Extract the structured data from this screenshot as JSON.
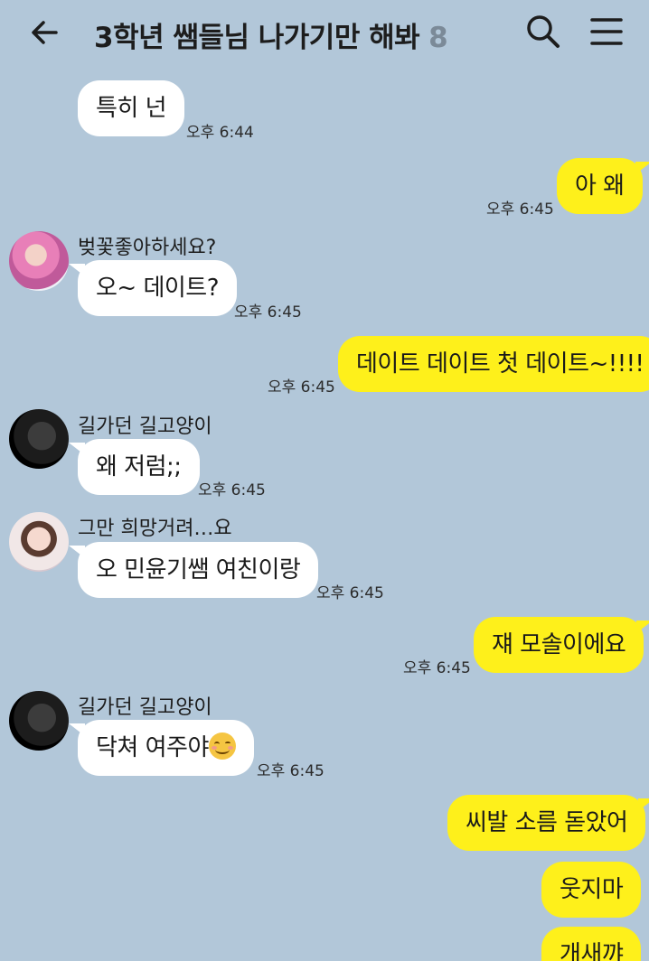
{
  "header": {
    "title": "3학년 쌤들님 나가기만 해봐",
    "member_count": "8",
    "back_icon": "arrow-left-icon",
    "search_icon": "search-icon",
    "menu_icon": "hamburger-menu-icon"
  },
  "colors": {
    "background": "#b2c7d9",
    "incoming_bubble": "#ffffff",
    "outgoing_bubble": "#fef01b"
  },
  "messages": [
    {
      "direction": "in",
      "sender": "",
      "text": "특히 넌",
      "time": "오후 6:44"
    },
    {
      "direction": "out",
      "text": "아 왜",
      "time": "오후 6:45"
    },
    {
      "direction": "in",
      "sender": "벚꽃좋아하세요?",
      "text": "오~ 데이트?",
      "time": "오후 6:45"
    },
    {
      "direction": "out",
      "text": "데이트 데이트 첫 데이트~!!!!",
      "time": "오후 6:45"
    },
    {
      "direction": "in",
      "sender": "길가던 길고양이",
      "text": "왜 저럼;;",
      "time": "오후 6:45"
    },
    {
      "direction": "in",
      "sender": "그만 희망거려…요",
      "text": "오 민윤기쌤 여친이랑",
      "time": "오후 6:45"
    },
    {
      "direction": "out",
      "text": "쟤 모솔이에요",
      "time": "오후 6:45"
    },
    {
      "direction": "in",
      "sender": "길가던 길고양이",
      "text": "닥쳐 여주야",
      "emoji": "smiling-face-emoji",
      "time": "오후 6:45"
    },
    {
      "direction": "out",
      "text": "씨발 소름 돋았어",
      "time": ""
    },
    {
      "direction": "out",
      "text": "웃지마",
      "time": ""
    },
    {
      "direction": "out",
      "text": "개새꺄",
      "time": ""
    }
  ]
}
